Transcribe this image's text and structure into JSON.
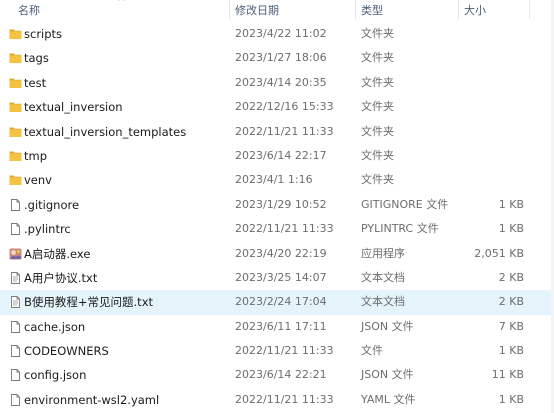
{
  "header": {
    "name": "名称",
    "date": "修改日期",
    "type": "类型",
    "size": "大小",
    "sort_indicator": "^"
  },
  "colors": {
    "folder": "#f5c242",
    "folder_dark": "#e0a82e",
    "selected_row": "#e5f3fb",
    "header_text": "#4c607a"
  },
  "files": [
    {
      "name": "scripts",
      "date": "2023/4/22 11:02",
      "type": "文件夹",
      "size": "",
      "icon": "folder-icon"
    },
    {
      "name": "tags",
      "date": "2023/1/27 18:06",
      "type": "文件夹",
      "size": "",
      "icon": "folder-icon"
    },
    {
      "name": "test",
      "date": "2023/4/14 20:35",
      "type": "文件夹",
      "size": "",
      "icon": "folder-icon"
    },
    {
      "name": "textual_inversion",
      "date": "2022/12/16 15:33",
      "type": "文件夹",
      "size": "",
      "icon": "folder-icon"
    },
    {
      "name": "textual_inversion_templates",
      "date": "2022/11/21 11:33",
      "type": "文件夹",
      "size": "",
      "icon": "folder-icon"
    },
    {
      "name": "tmp",
      "date": "2023/6/14 22:17",
      "type": "文件夹",
      "size": "",
      "icon": "folder-icon"
    },
    {
      "name": "venv",
      "date": "2023/4/1 1:16",
      "type": "文件夹",
      "size": "",
      "icon": "folder-icon"
    },
    {
      "name": ".gitignore",
      "date": "2023/1/29 10:52",
      "type": "GITIGNORE 文件",
      "size": "1 KB",
      "icon": "file-icon"
    },
    {
      "name": ".pylintrc",
      "date": "2022/11/21 11:33",
      "type": "PYLINTRC 文件",
      "size": "1 KB",
      "icon": "file-icon"
    },
    {
      "name": "A启动器.exe",
      "date": "2023/4/20 22:19",
      "type": "应用程序",
      "size": "2,051 KB",
      "icon": "app-icon"
    },
    {
      "name": "A用户协议.txt",
      "date": "2023/3/25 14:07",
      "type": "文本文档",
      "size": "2 KB",
      "icon": "text-file-icon"
    },
    {
      "name": "B使用教程+常见问题.txt",
      "date": "2023/2/24 17:04",
      "type": "文本文档",
      "size": "2 KB",
      "icon": "text-file-icon",
      "selected": true
    },
    {
      "name": "cache.json",
      "date": "2023/6/11 17:11",
      "type": "JSON 文件",
      "size": "7 KB",
      "icon": "file-icon"
    },
    {
      "name": "CODEOWNERS",
      "date": "2022/11/21 11:33",
      "type": "文件",
      "size": "1 KB",
      "icon": "file-icon"
    },
    {
      "name": "config.json",
      "date": "2023/6/14 22:21",
      "type": "JSON 文件",
      "size": "11 KB",
      "icon": "file-icon"
    },
    {
      "name": "environment-wsl2.yaml",
      "date": "2022/11/21 11:33",
      "type": "YAML 文件",
      "size": "1 KB",
      "icon": "file-icon"
    }
  ]
}
